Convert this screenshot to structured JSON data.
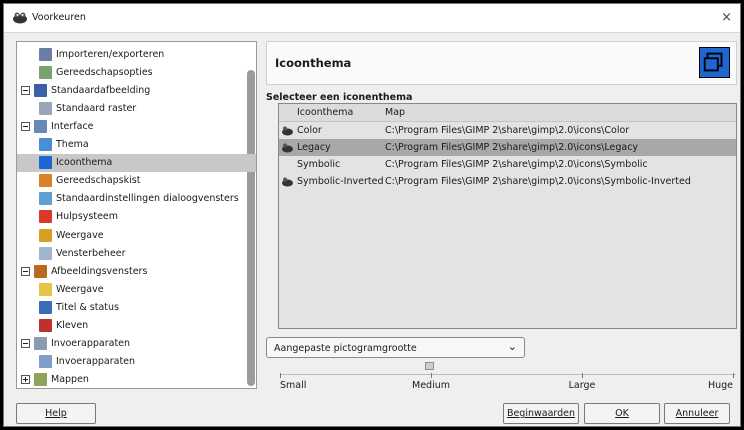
{
  "window": {
    "title": "Voorkeuren",
    "close_glyph": "×"
  },
  "tree": {
    "items": [
      {
        "label": "Importeren/exporteren",
        "level": 1,
        "icon": "import-export-icon",
        "color": "#6b7fa6"
      },
      {
        "label": "Gereedschapsopties",
        "level": 1,
        "icon": "tool-options-icon",
        "color": "#7aa36b"
      },
      {
        "label": "Standaardafbeelding",
        "level": 0,
        "icon": "default-image-icon",
        "color": "#3d5fa6",
        "expander": "minus"
      },
      {
        "label": "Standaard raster",
        "level": 1,
        "icon": "default-grid-icon",
        "color": "#9aa5b8"
      },
      {
        "label": "Interface",
        "level": 0,
        "icon": "interface-icon",
        "color": "#6688bb",
        "expander": "minus"
      },
      {
        "label": "Thema",
        "level": 1,
        "icon": "theme-icon",
        "color": "#4a8fd6"
      },
      {
        "label": "Icoonthema",
        "level": 1,
        "icon": "icon-theme-icon",
        "color": "#1e66d0",
        "selected": true
      },
      {
        "label": "Gereedschapskist",
        "level": 1,
        "icon": "toolbox-icon",
        "color": "#d9822b"
      },
      {
        "label": "Standaardinstellingen dialoogvensters",
        "level": 1,
        "icon": "dialog-defaults-icon",
        "color": "#5fa0d0"
      },
      {
        "label": "Hulpsysteem",
        "level": 1,
        "icon": "help-system-icon",
        "color": "#d83a2a"
      },
      {
        "label": "Weergave",
        "level": 1,
        "icon": "display-icon",
        "color": "#d8a020"
      },
      {
        "label": "Vensterbeheer",
        "level": 1,
        "icon": "window-management-icon",
        "color": "#9fb5d0"
      },
      {
        "label": "Afbeeldingsvensters",
        "level": 0,
        "icon": "image-windows-icon",
        "color": "#b86a20",
        "expander": "minus"
      },
      {
        "label": "Weergave",
        "level": 1,
        "icon": "appearance-icon",
        "color": "#e8c34a"
      },
      {
        "label": "Titel & status",
        "level": 1,
        "icon": "title-status-icon",
        "color": "#3a6db8"
      },
      {
        "label": "Kleven",
        "level": 1,
        "icon": "snapping-icon",
        "color": "#c03030"
      },
      {
        "label": "Invoerapparaten",
        "level": 0,
        "icon": "input-devices-icon",
        "color": "#8a9cb0",
        "expander": "minus"
      },
      {
        "label": "Invoerapparaten",
        "level": 1,
        "icon": "input-controllers-icon",
        "color": "#7f9fc8"
      },
      {
        "label": "Mappen",
        "level": 0,
        "icon": "folders-icon",
        "color": "#8fa35a",
        "expander": "plus"
      }
    ]
  },
  "panel": {
    "title": "Icoonthema",
    "header_icon": "icon-theme-icon",
    "section_label": "Selecteer een iconenthema",
    "columns": {
      "name": "Icoonthema",
      "path": "Map"
    },
    "themes": [
      {
        "name": "Color",
        "path": "C:\\Program Files\\GIMP 2\\share\\gimp\\2.0\\icons\\Color",
        "icon": "wilber-color-icon"
      },
      {
        "name": "Legacy",
        "path": "C:\\Program Files\\GIMP 2\\share\\gimp\\2.0\\icons\\Legacy",
        "icon": "wilber-legacy-icon",
        "selected": true
      },
      {
        "name": "Symbolic",
        "path": "C:\\Program Files\\GIMP 2\\share\\gimp\\2.0\\icons\\Symbolic",
        "icon": ""
      },
      {
        "name": "Symbolic-Inverted",
        "path": "C:\\Program Files\\GIMP 2\\share\\gimp\\2.0\\icons\\Symbolic-Inverted",
        "icon": "wilber-symbolic-inverted-icon"
      }
    ],
    "size_combo": {
      "value": "Aangepaste pictogramgrootte"
    },
    "size_slider": {
      "labels": [
        "Small",
        "Medium",
        "Large",
        "Huge"
      ],
      "value_fraction": 0.33
    }
  },
  "buttons": {
    "help": "Help",
    "reset": "Beginwaarden",
    "ok": "OK",
    "cancel": "Annuleer"
  }
}
